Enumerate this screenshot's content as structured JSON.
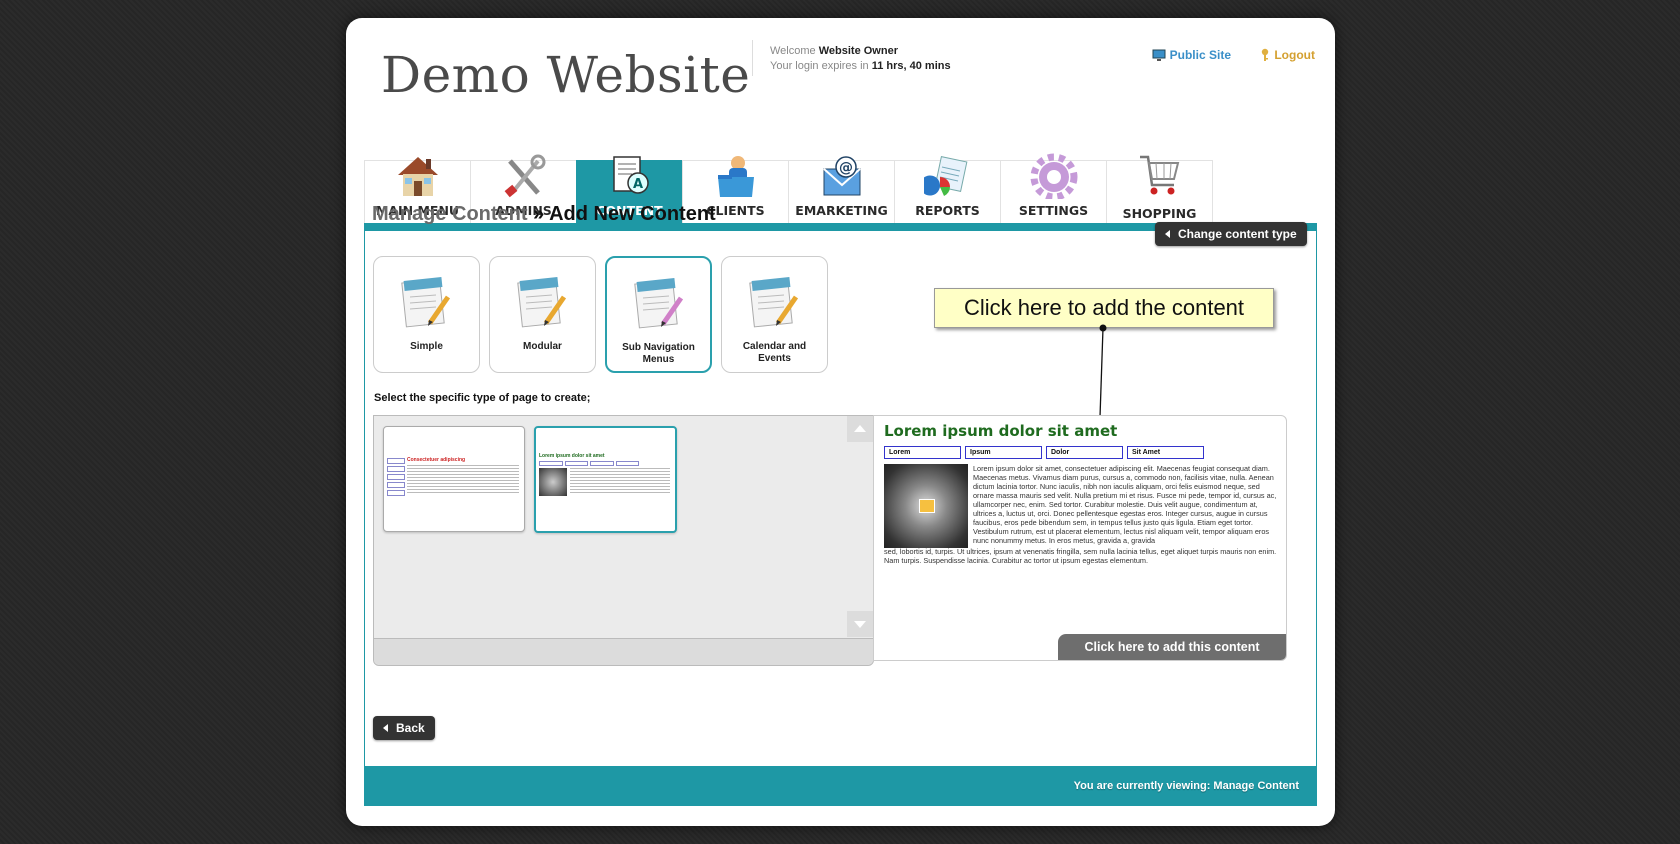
{
  "header": {
    "site_title": "Demo Website",
    "welcome_prefix": "Welcome",
    "user_name": "Website Owner",
    "login_prefix": "Your login expires in",
    "login_time": "11 hrs, 40 mins",
    "public_site": "Public Site",
    "logout": "Logout"
  },
  "nav": {
    "tabs": [
      {
        "label": "MAIN MENU",
        "icon": "house-icon"
      },
      {
        "label": "ADMINS",
        "icon": "tools-icon"
      },
      {
        "label": "CONTENT",
        "icon": "document-icon",
        "active": true
      },
      {
        "label": "CLIENTS",
        "icon": "client-folder-icon"
      },
      {
        "label": "EMARKETING",
        "icon": "email-icon"
      },
      {
        "label": "REPORTS",
        "icon": "reports-icon"
      },
      {
        "label": "SETTINGS",
        "icon": "gear-icon"
      },
      {
        "label": "SHOPPING",
        "icon": "cart-icon"
      }
    ]
  },
  "page": {
    "breadcrumb_parent": "Manage Content",
    "breadcrumb_sep": " » ",
    "breadcrumb_current": "Add New Content",
    "change_type_button": "Change content type",
    "select_label": "Select the specific type of page to create;",
    "back_button": "Back"
  },
  "content_types": [
    {
      "label": "Simple"
    },
    {
      "label": "Modular"
    },
    {
      "label": "Sub Navigation Menus",
      "selected": true
    },
    {
      "label": "Calendar and Events"
    }
  ],
  "callout": "Click here to add the content",
  "thumbnails": [
    {
      "title": "Consectetuer adipiscing"
    },
    {
      "title": "Lorem ipsum dolor sit amet",
      "selected": true
    }
  ],
  "preview": {
    "title": "Lorem ipsum dolor sit amet",
    "tabs": [
      "Lorem",
      "Ipsum",
      "Dolor",
      "Sit Amet"
    ],
    "body_side": "Lorem ipsum dolor sit amet, consectetuer adipiscing elit. Maecenas feugiat consequat diam. Maecenas metus. Vivamus diam purus, cursus a, commodo non, facilisis vitae, nulla. Aenean dictum lacinia tortor. Nunc iaculis, nibh non iaculis aliquam, orci felis euismod neque, sed ornare massa mauris sed velit. Nulla pretium mi et risus. Fusce mi pede, tempor id, cursus ac, ullamcorper nec, enim. Sed tortor. Curabitur molestie. Duis velit augue, condimentum at, ultrices a, luctus ut, orci. Donec pellentesque egestas eros. Integer cursus, augue in cursus faucibus, eros pede bibendum sem, in tempus tellus justo quis ligula. Etiam eget tortor. Vestibulum rutrum, est ut placerat elementum, lectus nisl aliquam velit, tempor aliquam eros nunc nonummy metus. In eros metus, gravida a, gravida",
    "body_full": "sed, lobortis id, turpis. Ut ultrices, ipsum at venenatis fringilla, sem nulla lacinia tellus, eget aliquet turpis mauris non enim. Nam turpis. Suspendisse lacinia. Curabitur ac tortor ut ipsum egestas elementum.",
    "add_button": "Click here to add this content"
  },
  "footer": {
    "status": "You are currently viewing: Manage Content"
  }
}
